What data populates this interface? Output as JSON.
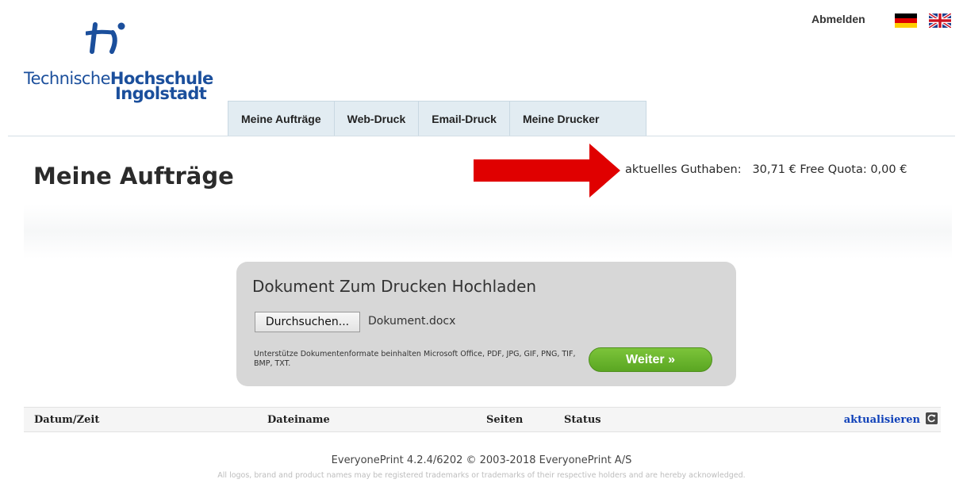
{
  "logo": {
    "line1_regular": "Technische",
    "line1_bold": "Hochschule",
    "line2": "Ingolstadt"
  },
  "header": {
    "logout_label": "Abmelden",
    "languages": [
      "de-flag-icon",
      "gb-flag-icon"
    ]
  },
  "tabs": [
    {
      "label": "Meine Aufträge"
    },
    {
      "label": "Web-Druck"
    },
    {
      "label": "Email-Druck"
    },
    {
      "label": "Meine Drucker"
    }
  ],
  "main": {
    "title": "Meine Aufträge",
    "balance_label": "aktuelles Guthaben:",
    "balance_value": "30,71 €",
    "quota_label": "Free Quota:",
    "quota_value": "0,00 €"
  },
  "upload": {
    "title": "Dokument Zum Drucken Hochladen",
    "browse_label": "Durchsuchen...",
    "file_name": "Dokument.docx",
    "formats_text": "Unterstütze Dokumentenformate beinhalten Microsoft Office, PDF, JPG, GIF, PNG, TIF, BMP, TXT.",
    "next_label": "Weiter »"
  },
  "table": {
    "columns": [
      "Datum/Zeit",
      "Dateiname",
      "Seiten",
      "Status"
    ],
    "refresh_label": "aktualisieren"
  },
  "footer": {
    "version": "EveryonePrint 4.2.4/6202 © 2003-2018 EveryonePrint A/S",
    "legal": "All logos, brand and product names may be registered trademarks or trademarks of their respective holders and are hereby acknowledged."
  },
  "colors": {
    "brand_blue": "#1b4f9c",
    "arrow_red": "#e00000",
    "button_green": "#6bb52d",
    "link_blue": "#0d3fb8"
  }
}
